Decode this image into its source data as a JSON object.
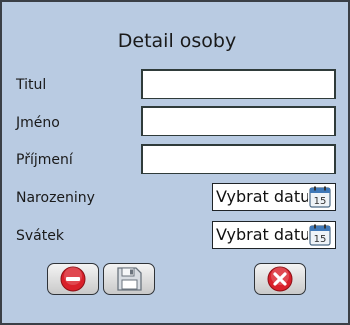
{
  "dialog": {
    "title": "Detail osoby"
  },
  "fields": {
    "titul": {
      "label": "Titul",
      "value": ""
    },
    "jmeno": {
      "label": "Jméno",
      "value": ""
    },
    "prijmeni": {
      "label": "Příjmení",
      "value": ""
    },
    "narozeniny": {
      "label": "Narozeniny",
      "value": "Vybrat datu",
      "icon": "calendar-icon",
      "day": "15"
    },
    "svatek": {
      "label": "Svátek",
      "value": "Vybrat datu",
      "icon": "calendar-icon",
      "day": "15"
    }
  },
  "buttons": {
    "delete": {
      "icon": "minus-circle-icon",
      "color": "#d9202a"
    },
    "save": {
      "icon": "floppy-disk-icon"
    },
    "close": {
      "icon": "close-circle-icon",
      "color": "#d9202a"
    }
  },
  "colors": {
    "dialog_bg": "#b9cbe2",
    "accent_red": "#d9202a"
  }
}
